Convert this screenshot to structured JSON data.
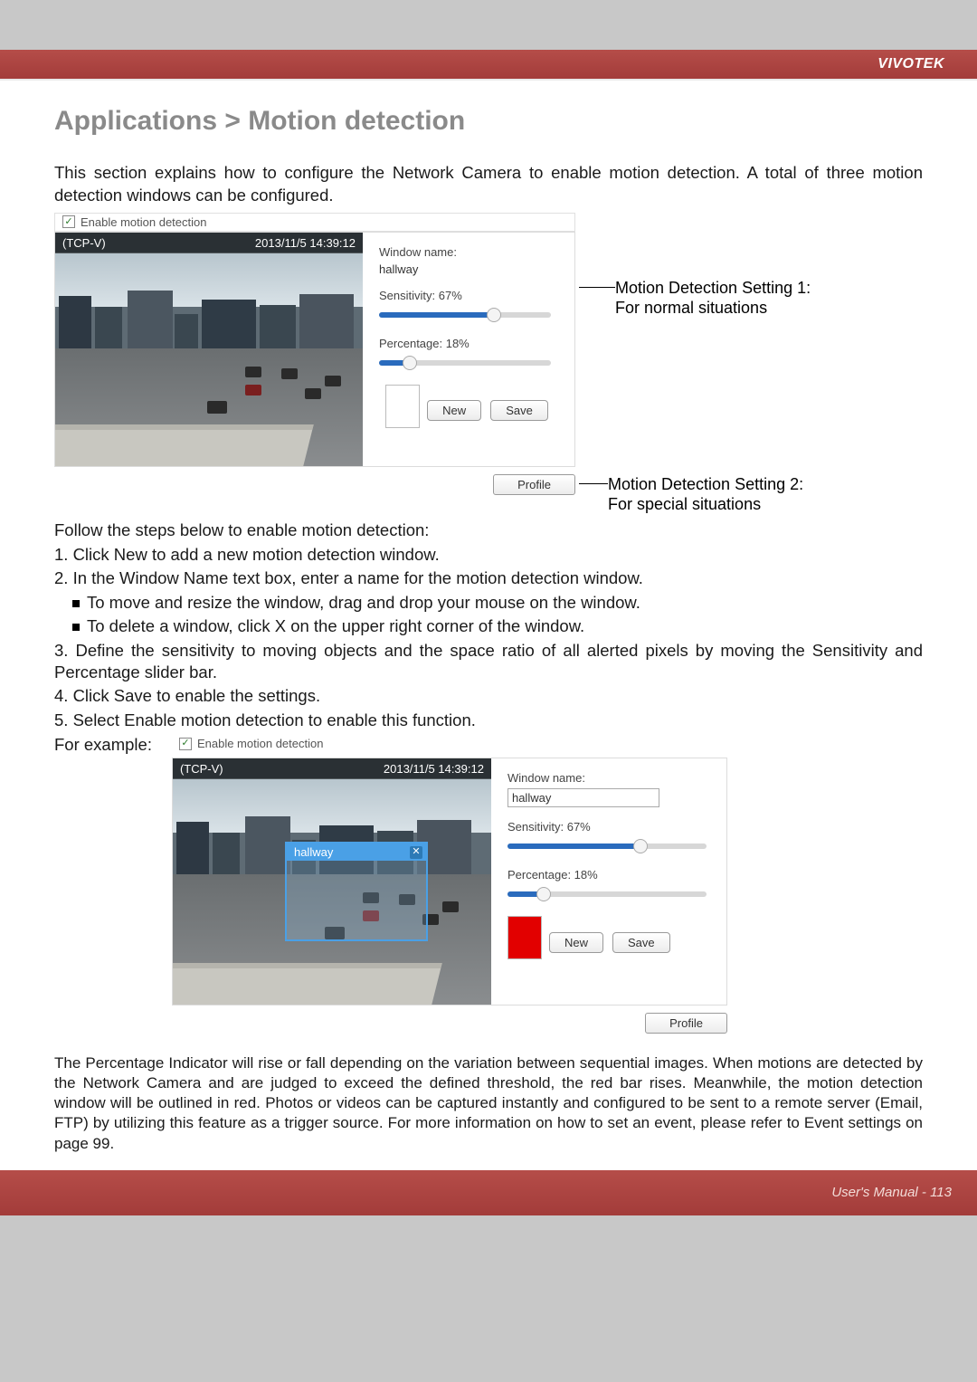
{
  "brand": "VIVOTEK",
  "title": "Applications > Motion detection",
  "intro": "This section explains how to configure the Network Camera to enable motion detection. A total of three motion detection windows can be configured.",
  "enable_label": "Enable motion detection",
  "overlay": {
    "name": "(TCP-V)",
    "timestamp": "2013/11/5 14:39:12"
  },
  "settings": {
    "window_name_label": "Window name:",
    "window_name_value": "hallway",
    "sensitivity_label": "Sensitivity: 67%",
    "sensitivity_pct": 67,
    "percentage_label": "Percentage: 18%",
    "percentage_pct": 18,
    "new_btn": "New",
    "save_btn": "Save",
    "profile_btn": "Profile"
  },
  "annot1": "Motion Detection Setting 1:\nFor normal situations",
  "annot2": "Motion Detection Setting 2:\nFor special situations",
  "follow": "Follow the steps below to enable motion detection:",
  "steps": {
    "s1": "1. Click New to add a new motion detection window.",
    "s2": "2. In the Window Name text box, enter a name for the motion detection window.",
    "s2a": "To move and resize the window, drag and drop your mouse on the window.",
    "s2b": "To delete a window, click X on the upper right corner of the window.",
    "s3": "3. Define the sensitivity to moving objects and the space ratio of all alerted pixels by moving the Sensitivity and Percentage slider bar.",
    "s4": "4. Click Save to enable the settings.",
    "s5": "5. Select Enable motion detection to enable this function."
  },
  "example_label": "For example:",
  "md_window_title": "hallway",
  "final_para": "The Percentage Indicator will rise or fall depending on the variation between sequential images. When motions are detected by the Network Camera and are judged to exceed the defined threshold, the red bar rises. Meanwhile, the motion detection window will be outlined in red. Photos or videos can be captured instantly and configured to be sent to a remote server (Email, FTP) by utilizing this feature as a trigger source. For more information on how to set an event, please refer to Event settings on page 99.",
  "footer": "User's Manual - 113"
}
